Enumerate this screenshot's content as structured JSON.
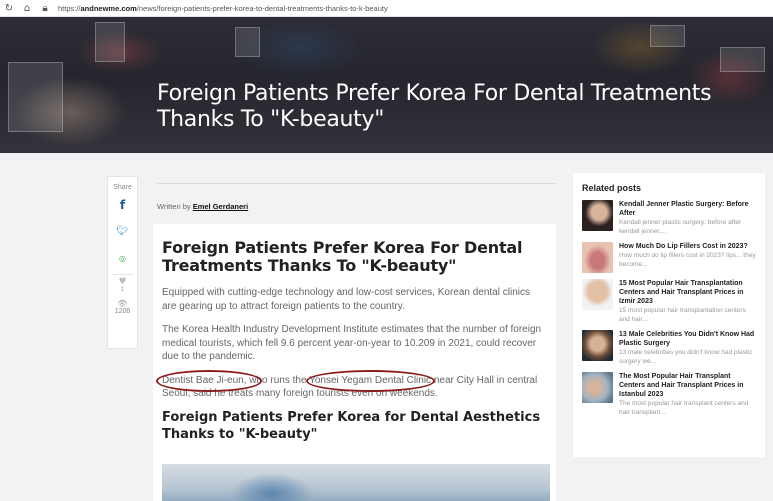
{
  "browser": {
    "url_prefix": "https://",
    "url_domain": "andnewme.com",
    "url_path": "/news/foreign-patients-prefer-korea-to-dental-treatments-thanks-to-k-beauty"
  },
  "hero": {
    "title": "Foreign Patients Prefer Korea For Dental Treatments Thanks To \"K-beauty\""
  },
  "share": {
    "label": "Share",
    "likes": "1",
    "views": "1206"
  },
  "byline": {
    "prefix": "Written by ",
    "author": "Emel Gerdaneri"
  },
  "article": {
    "heading": "Foreign Patients Prefer Korea For Dental Treatments Thanks To \"K-beauty\"",
    "p1": "Equipped with cutting-edge technology and low-cost services, Korean dental clinics are gearing up to attract foreign patients to the country.",
    "p2": "The Korea Health Industry Development Institute estimates that the number of foreign medical tourists, which fell 9.6 percent year-on-year to 10.209 in 2021, could recover due to the pandemic.",
    "p3": "Dentist Bae Ji-eun, who runs the Yonsei Yegam Dental Clinic near City Hall in central Seoul, said he treats many foreign tourists even on weekends.",
    "subheading": "Foreign Patients Prefer Korea for Dental Aesthetics Thanks to \"K-beauty\""
  },
  "sidebar": {
    "title": "Related posts",
    "posts": [
      {
        "title": "Kendall Jenner Plastic Surgery: Before After",
        "excerpt": "Kendall jenner plastic surgery: before after kendall jenner,..."
      },
      {
        "title": "How Much Do Lip Fillers Cost in 2023?",
        "excerpt": "How much do lip fillers cost in 2023? lips... they become..."
      },
      {
        "title": "15 Most Popular Hair Transplantation Centers and Hair Transplant Prices in Izmir 2023",
        "excerpt": "15 most popular hair transplantation centers and hair..."
      },
      {
        "title": "13 Male Celebrities You Didn't Know Had Plastic Surgery",
        "excerpt": "13 male celebrities you didn't know had plastic surgery we..."
      },
      {
        "title": "The Most Popular Hair Transplant Centers and Hair Transplant Prices in Istanbul 2023",
        "excerpt": "The most popular hair transplant centers and hair transplant..."
      }
    ]
  },
  "colors": {
    "annotation_circle": "#8c1b1b",
    "facebook": "#1f5aa6",
    "twitter": "#2d8fd5",
    "whatsapp": "#37b24d"
  }
}
